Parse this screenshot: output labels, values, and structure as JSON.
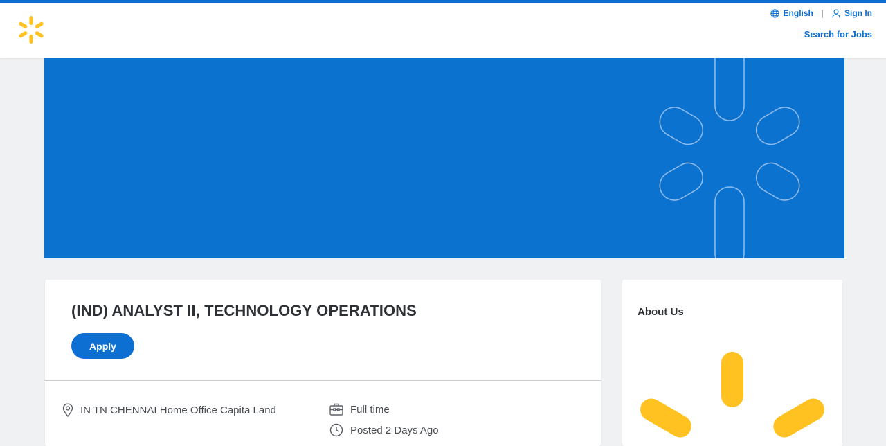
{
  "header": {
    "language_label": "English",
    "sign_in_label": "Sign In",
    "search_jobs_label": "Search for Jobs"
  },
  "job": {
    "title": "(IND) ANALYST II, TECHNOLOGY OPERATIONS",
    "apply_label": "Apply",
    "location": "IN TN CHENNAI Home Office Capita Land",
    "employment_type": "Full time",
    "posted": "Posted 2 Days Ago"
  },
  "about": {
    "title": "About Us"
  },
  "colors": {
    "brand_blue": "#0d6fd1",
    "banner_blue": "#0b72d0",
    "spark_yellow": "#ffc220"
  },
  "icons": {
    "language": "globe-icon",
    "sign_in": "user-icon",
    "location": "location-pin-icon",
    "employment_type": "briefcase-icon",
    "posted": "clock-icon"
  }
}
